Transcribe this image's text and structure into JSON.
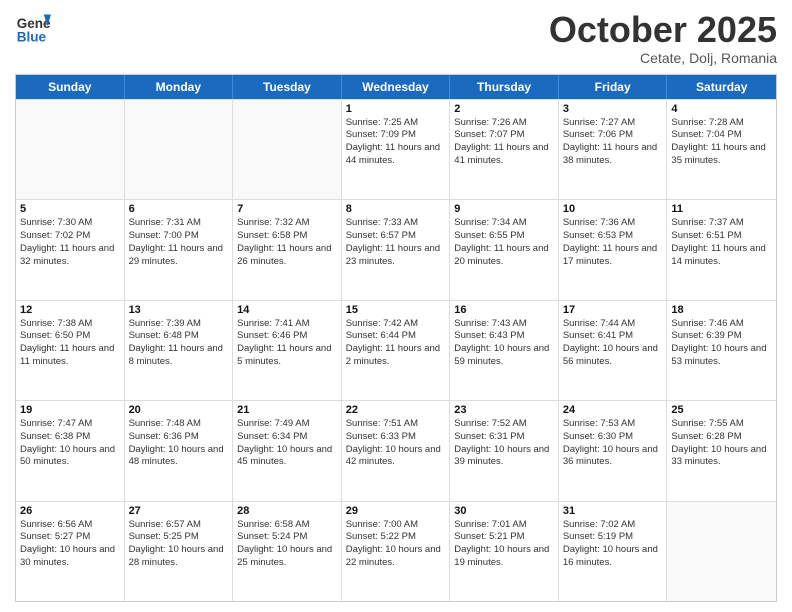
{
  "header": {
    "logo_line1": "General",
    "logo_line2": "Blue",
    "month": "October 2025",
    "location": "Cetate, Dolj, Romania"
  },
  "weekdays": [
    "Sunday",
    "Monday",
    "Tuesday",
    "Wednesday",
    "Thursday",
    "Friday",
    "Saturday"
  ],
  "weeks": [
    [
      {
        "day": "",
        "empty": true
      },
      {
        "day": "",
        "empty": true
      },
      {
        "day": "",
        "empty": true
      },
      {
        "day": "1",
        "sunrise": "7:25 AM",
        "sunset": "7:09 PM",
        "daylight": "11 hours and 44 minutes."
      },
      {
        "day": "2",
        "sunrise": "7:26 AM",
        "sunset": "7:07 PM",
        "daylight": "11 hours and 41 minutes."
      },
      {
        "day": "3",
        "sunrise": "7:27 AM",
        "sunset": "7:06 PM",
        "daylight": "11 hours and 38 minutes."
      },
      {
        "day": "4",
        "sunrise": "7:28 AM",
        "sunset": "7:04 PM",
        "daylight": "11 hours and 35 minutes."
      }
    ],
    [
      {
        "day": "5",
        "sunrise": "7:30 AM",
        "sunset": "7:02 PM",
        "daylight": "11 hours and 32 minutes."
      },
      {
        "day": "6",
        "sunrise": "7:31 AM",
        "sunset": "7:00 PM",
        "daylight": "11 hours and 29 minutes."
      },
      {
        "day": "7",
        "sunrise": "7:32 AM",
        "sunset": "6:58 PM",
        "daylight": "11 hours and 26 minutes."
      },
      {
        "day": "8",
        "sunrise": "7:33 AM",
        "sunset": "6:57 PM",
        "daylight": "11 hours and 23 minutes."
      },
      {
        "day": "9",
        "sunrise": "7:34 AM",
        "sunset": "6:55 PM",
        "daylight": "11 hours and 20 minutes."
      },
      {
        "day": "10",
        "sunrise": "7:36 AM",
        "sunset": "6:53 PM",
        "daylight": "11 hours and 17 minutes."
      },
      {
        "day": "11",
        "sunrise": "7:37 AM",
        "sunset": "6:51 PM",
        "daylight": "11 hours and 14 minutes."
      }
    ],
    [
      {
        "day": "12",
        "sunrise": "7:38 AM",
        "sunset": "6:50 PM",
        "daylight": "11 hours and 11 minutes."
      },
      {
        "day": "13",
        "sunrise": "7:39 AM",
        "sunset": "6:48 PM",
        "daylight": "11 hours and 8 minutes."
      },
      {
        "day": "14",
        "sunrise": "7:41 AM",
        "sunset": "6:46 PM",
        "daylight": "11 hours and 5 minutes."
      },
      {
        "day": "15",
        "sunrise": "7:42 AM",
        "sunset": "6:44 PM",
        "daylight": "11 hours and 2 minutes."
      },
      {
        "day": "16",
        "sunrise": "7:43 AM",
        "sunset": "6:43 PM",
        "daylight": "10 hours and 59 minutes."
      },
      {
        "day": "17",
        "sunrise": "7:44 AM",
        "sunset": "6:41 PM",
        "daylight": "10 hours and 56 minutes."
      },
      {
        "day": "18",
        "sunrise": "7:46 AM",
        "sunset": "6:39 PM",
        "daylight": "10 hours and 53 minutes."
      }
    ],
    [
      {
        "day": "19",
        "sunrise": "7:47 AM",
        "sunset": "6:38 PM",
        "daylight": "10 hours and 50 minutes."
      },
      {
        "day": "20",
        "sunrise": "7:48 AM",
        "sunset": "6:36 PM",
        "daylight": "10 hours and 48 minutes."
      },
      {
        "day": "21",
        "sunrise": "7:49 AM",
        "sunset": "6:34 PM",
        "daylight": "10 hours and 45 minutes."
      },
      {
        "day": "22",
        "sunrise": "7:51 AM",
        "sunset": "6:33 PM",
        "daylight": "10 hours and 42 minutes."
      },
      {
        "day": "23",
        "sunrise": "7:52 AM",
        "sunset": "6:31 PM",
        "daylight": "10 hours and 39 minutes."
      },
      {
        "day": "24",
        "sunrise": "7:53 AM",
        "sunset": "6:30 PM",
        "daylight": "10 hours and 36 minutes."
      },
      {
        "day": "25",
        "sunrise": "7:55 AM",
        "sunset": "6:28 PM",
        "daylight": "10 hours and 33 minutes."
      }
    ],
    [
      {
        "day": "26",
        "sunrise": "6:56 AM",
        "sunset": "5:27 PM",
        "daylight": "10 hours and 30 minutes."
      },
      {
        "day": "27",
        "sunrise": "6:57 AM",
        "sunset": "5:25 PM",
        "daylight": "10 hours and 28 minutes."
      },
      {
        "day": "28",
        "sunrise": "6:58 AM",
        "sunset": "5:24 PM",
        "daylight": "10 hours and 25 minutes."
      },
      {
        "day": "29",
        "sunrise": "7:00 AM",
        "sunset": "5:22 PM",
        "daylight": "10 hours and 22 minutes."
      },
      {
        "day": "30",
        "sunrise": "7:01 AM",
        "sunset": "5:21 PM",
        "daylight": "10 hours and 19 minutes."
      },
      {
        "day": "31",
        "sunrise": "7:02 AM",
        "sunset": "5:19 PM",
        "daylight": "10 hours and 16 minutes."
      },
      {
        "day": "",
        "empty": true
      }
    ]
  ]
}
